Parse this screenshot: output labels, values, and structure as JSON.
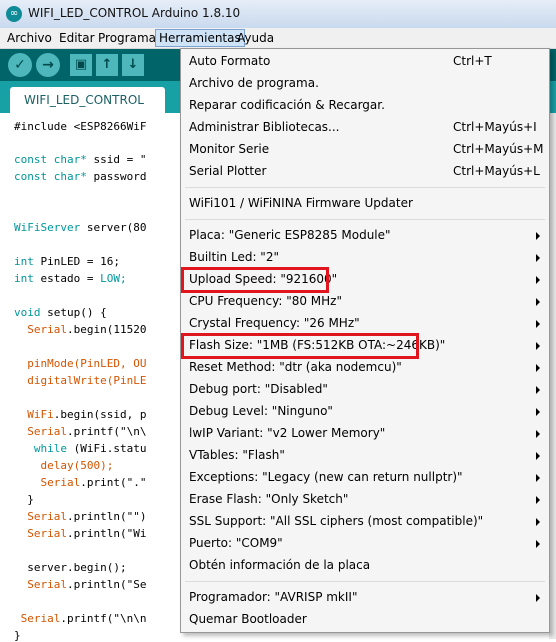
{
  "window": {
    "title": "WIFI_LED_CONTROL Arduino 1.8.10",
    "icon": "arduino-logo-icon"
  },
  "menubar": [
    "Archivo",
    "Editar",
    "Programa",
    "Herramientas",
    "Ayuda"
  ],
  "toolbar": {
    "buttons": [
      "verify-icon",
      "upload-icon",
      "new-icon",
      "open-icon",
      "save-icon"
    ],
    "glyphs": [
      "✓",
      "→",
      "▣",
      "↑",
      "↓"
    ]
  },
  "tab": {
    "label": "WIFI_LED_CONTROL"
  },
  "code": {
    "include": "#include <ESP8266WiF",
    "ssid_kw": "const char*",
    "ssid_rest": " ssid = \"",
    "pwd_kw": "const char*",
    "pwd_rest": " password",
    "server_kw": "WiFiServer",
    "server_rest": " server(80",
    "pin_kw": "int",
    "pin_rest": " PinLED = 16;",
    "estado_kw": "int",
    "estado_rest": " estado = ",
    "estado_val": "LOW;",
    "setup_kw": "void",
    "setup_rest": " setup() {",
    "serial_begin": "Serial",
    "serial_begin_rest": ".begin(11520",
    "pinmode": "pinMode(PinLED, OU",
    "digitalwrite": "digitalWrite(PinLE",
    "wifi_begin": "WiFi",
    "wifi_begin_rest": ".begin(ssid, p",
    "printf1": "Serial",
    "printf1_rest": ".printf(\"\\n\\",
    "while_kw": "while",
    "while_rest": " (WiFi.statu",
    "delay": "delay(500);",
    "print_dot": "Serial",
    "print_dot_rest": ".print(\".\"",
    "brace_close": "}",
    "println1": "Serial",
    "println1_rest": ".println(\"\")",
    "println2": "Serial",
    "println2_rest": ".println(\"Wi",
    "server_begin": "server.begin();",
    "println3": "Serial",
    "println3_rest": ".println(\"Se",
    "printf2": "Serial",
    "printf2_rest": ".printf(\"\\n\\n",
    "final_brace": "}"
  },
  "dropdown": {
    "items": [
      {
        "label": "Auto Formato",
        "shortcut": "Ctrl+T"
      },
      {
        "label": "Archivo de programa.",
        "shortcut": ""
      },
      {
        "label": "Reparar codificación & Recargar.",
        "shortcut": ""
      },
      {
        "label": "Administrar Bibliotecas...",
        "shortcut": "Ctrl+Mayús+I"
      },
      {
        "label": "Monitor Serie",
        "shortcut": "Ctrl+Mayús+M"
      },
      {
        "label": "Serial Plotter",
        "shortcut": "Ctrl+Mayús+L"
      },
      {
        "label": "WiFi101 / WiFiNINA Firmware Updater",
        "shortcut": ""
      },
      {
        "label": "Placa: \"Generic ESP8285 Module\"",
        "submenu": true
      },
      {
        "label": "Builtin Led: \"2\"",
        "submenu": true
      },
      {
        "label": "Upload Speed: \"921600\"",
        "submenu": true,
        "highlighted": true
      },
      {
        "label": "CPU Frequency: \"80 MHz\"",
        "submenu": true
      },
      {
        "label": "Crystal Frequency: \"26 MHz\"",
        "submenu": true
      },
      {
        "label": "Flash Size: \"1MB (FS:512KB OTA:~246KB)\"",
        "submenu": true,
        "highlighted": true
      },
      {
        "label": "Reset Method: \"dtr (aka nodemcu)\"",
        "submenu": true
      },
      {
        "label": "Debug port: \"Disabled\"",
        "submenu": true
      },
      {
        "label": "Debug Level: \"Ninguno\"",
        "submenu": true
      },
      {
        "label": "lwIP Variant: \"v2 Lower Memory\"",
        "submenu": true
      },
      {
        "label": "VTables: \"Flash\"",
        "submenu": true
      },
      {
        "label": "Exceptions: \"Legacy (new can return nullptr)\"",
        "submenu": true
      },
      {
        "label": "Erase Flash: \"Only Sketch\"",
        "submenu": true
      },
      {
        "label": "SSL Support: \"All SSL ciphers (most compatible)\"",
        "submenu": true
      },
      {
        "label": "Puerto: \"COM9\"",
        "submenu": true
      },
      {
        "label": "Obtén información de la placa",
        "shortcut": ""
      },
      {
        "label": "Programador: \"AVRISP mkII\"",
        "submenu": true
      },
      {
        "label": "Quemar Bootloader",
        "shortcut": ""
      }
    ]
  },
  "colors": {
    "toolbar": "#006468",
    "tabstrip": "#17a1a5",
    "highlight_box": "#e0151d",
    "keyword": "#00979c"
  }
}
